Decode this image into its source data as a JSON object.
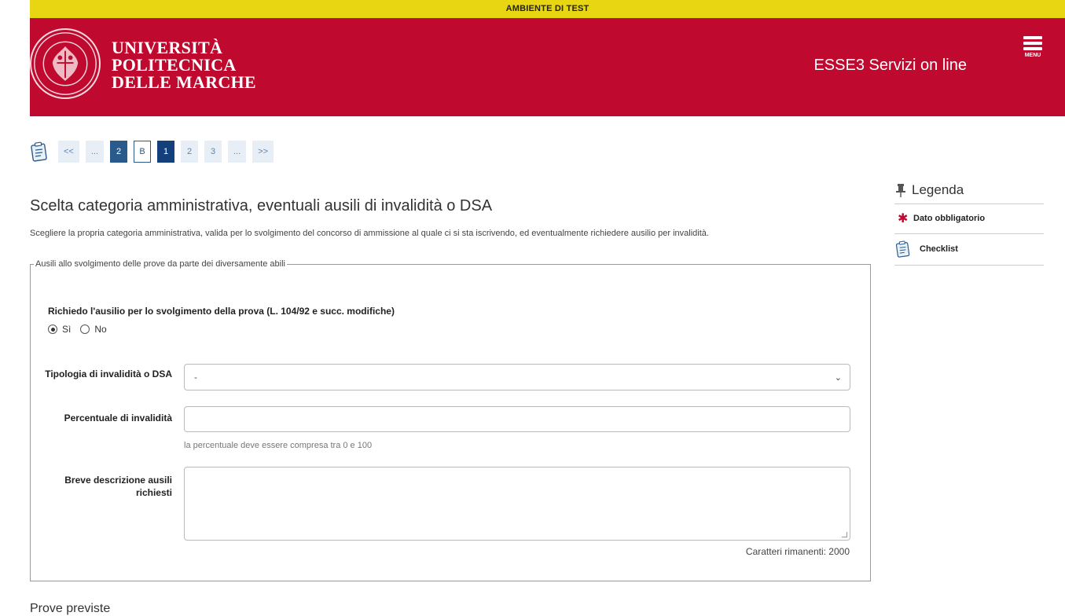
{
  "env_banner": "AMBIENTE DI TEST",
  "header": {
    "university_lines": [
      "UNIVERSITÀ",
      "POLITECNICA",
      "DELLE MARCHE"
    ],
    "app_title": "ESSE3 Servizi on line",
    "menu_label": "MENU",
    "brand_color": "#c0092f"
  },
  "pager": {
    "items": [
      "<<",
      "...",
      "2",
      "B",
      "1",
      "2",
      "3",
      "...",
      ">>"
    ],
    "current": "1"
  },
  "main": {
    "title": "Scelta categoria amministrativa, eventuali ausili di invalidità o DSA",
    "intro": "Scegliere la propria categoria amministrativa, valida per lo svolgimento del concorso di ammissione al quale ci si sta iscrivendo, ed eventualmente richiedere ausilio per invalidità.",
    "fieldset_legend": "Ausili allo svolgimento delle prove da parte dei diversamente abili",
    "question": "Richiedo l'ausilio per lo svolgimento della prova (L. 104/92 e succ. modifiche)",
    "radio_yes": "Sì",
    "radio_no": "No",
    "selected_radio": "Sì",
    "tipologia_label": "Tipologia di invalidità o DSA",
    "tipologia_value": "-",
    "percentuale_label": "Percentuale di invalidità",
    "percentuale_value": "",
    "percentuale_hint": "la percentuale deve essere compresa tra 0 e 100",
    "descrizione_label": "Breve descrizione ausili richiesti",
    "descrizione_value": "",
    "counter": "Caratteri rimanenti: 2000",
    "next_section": "Prove previste"
  },
  "legend": {
    "title": "Legenda",
    "items": [
      {
        "icon": "required-star-icon",
        "label": "Dato obbligatorio"
      },
      {
        "icon": "checklist-icon",
        "label": "Checklist"
      }
    ]
  }
}
